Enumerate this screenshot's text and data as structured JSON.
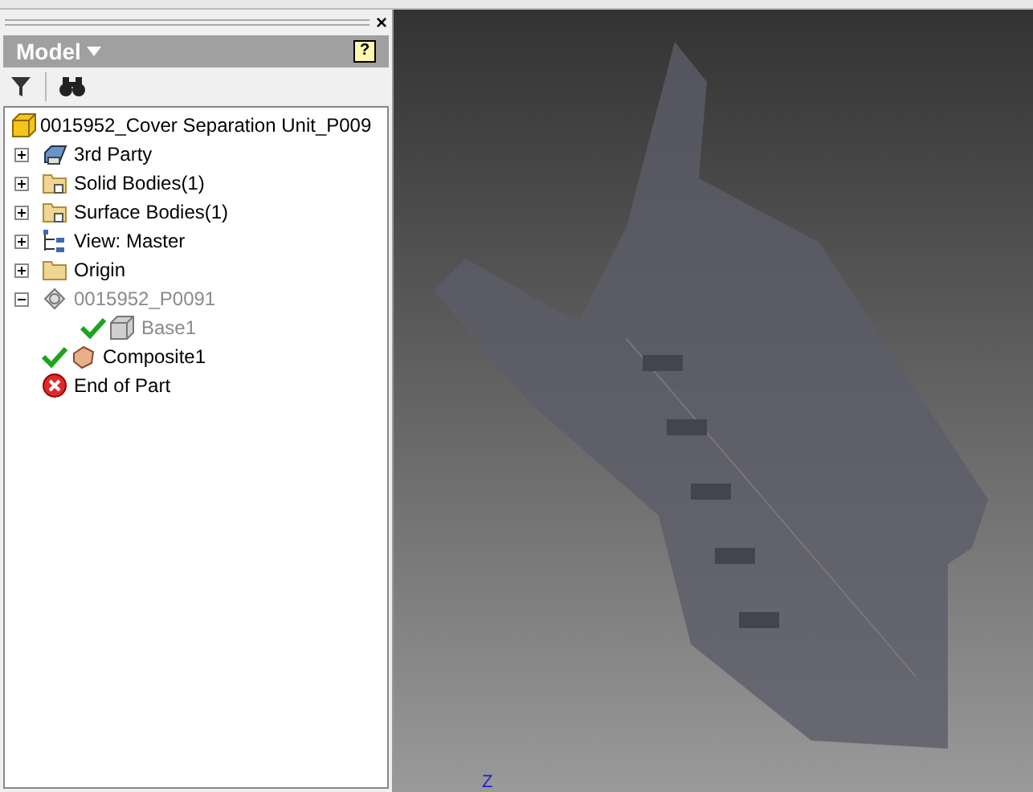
{
  "panel": {
    "title": "Model",
    "close": "×",
    "help": "?"
  },
  "tree": {
    "root": {
      "label": "0015952_Cover Separation Unit_P009",
      "kind": "part",
      "children": [
        {
          "label": "3rd Party",
          "kind": "third-party",
          "expanded": false,
          "disabled": false,
          "checked": false
        },
        {
          "label": "Solid Bodies(1)",
          "kind": "solid-folder",
          "expanded": false,
          "disabled": false,
          "checked": false
        },
        {
          "label": "Surface Bodies(1)",
          "kind": "surface-folder",
          "expanded": false,
          "disabled": false,
          "checked": false
        },
        {
          "label": "View: Master",
          "kind": "view",
          "expanded": false,
          "disabled": false,
          "checked": false
        },
        {
          "label": "Origin",
          "kind": "folder",
          "expanded": false,
          "disabled": false,
          "checked": false
        },
        {
          "label": "0015952_P0091",
          "kind": "derived",
          "expanded": true,
          "disabled": true,
          "checked": false,
          "children": [
            {
              "label": "Base1",
              "kind": "body",
              "disabled": true,
              "checked": true
            }
          ]
        },
        {
          "label": "Composite1",
          "kind": "composite",
          "disabled": false,
          "checked": true
        },
        {
          "label": "End of Part",
          "kind": "end",
          "disabled": false,
          "checked": false
        }
      ]
    }
  },
  "viewport": {
    "axis": "Z"
  }
}
